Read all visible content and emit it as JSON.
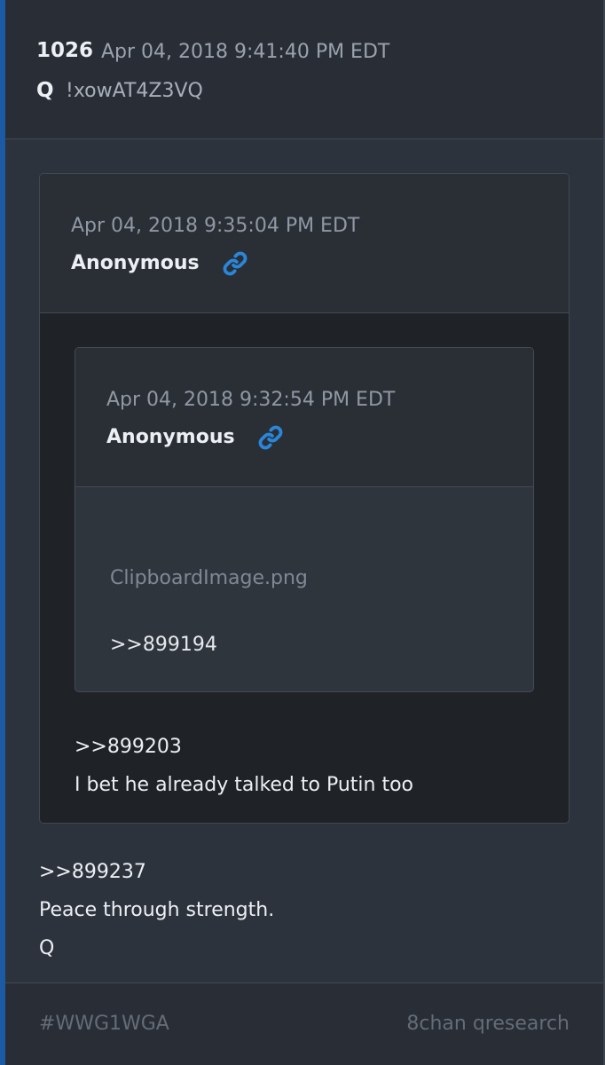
{
  "post": {
    "number": "1026",
    "date": "Apr 04, 2018 9:41:40 PM EDT",
    "author": "Q",
    "tripcode": "!xowAT4Z3VQ",
    "body": [
      ">>899237",
      "Peace through strength.",
      "Q"
    ]
  },
  "quoted": {
    "date": "Apr 04, 2018 9:35:04 PM EDT",
    "author": "Anonymous",
    "link_icon": "link-icon",
    "body": [
      ">>899203",
      "I bet he already talked to Putin too"
    ],
    "nested": {
      "date": "Apr 04, 2018 9:32:54 PM EDT",
      "author": "Anonymous",
      "link_icon": "link-icon",
      "file": "ClipboardImage.png",
      "ref": ">>899194"
    }
  },
  "footer": {
    "hashtag": "#WWG1WGA",
    "source": "8chan qresearch"
  },
  "colors": {
    "accent_border": "#1c5aa6",
    "link_icon": "#2a86d8",
    "card_bg": "#2d333c"
  }
}
